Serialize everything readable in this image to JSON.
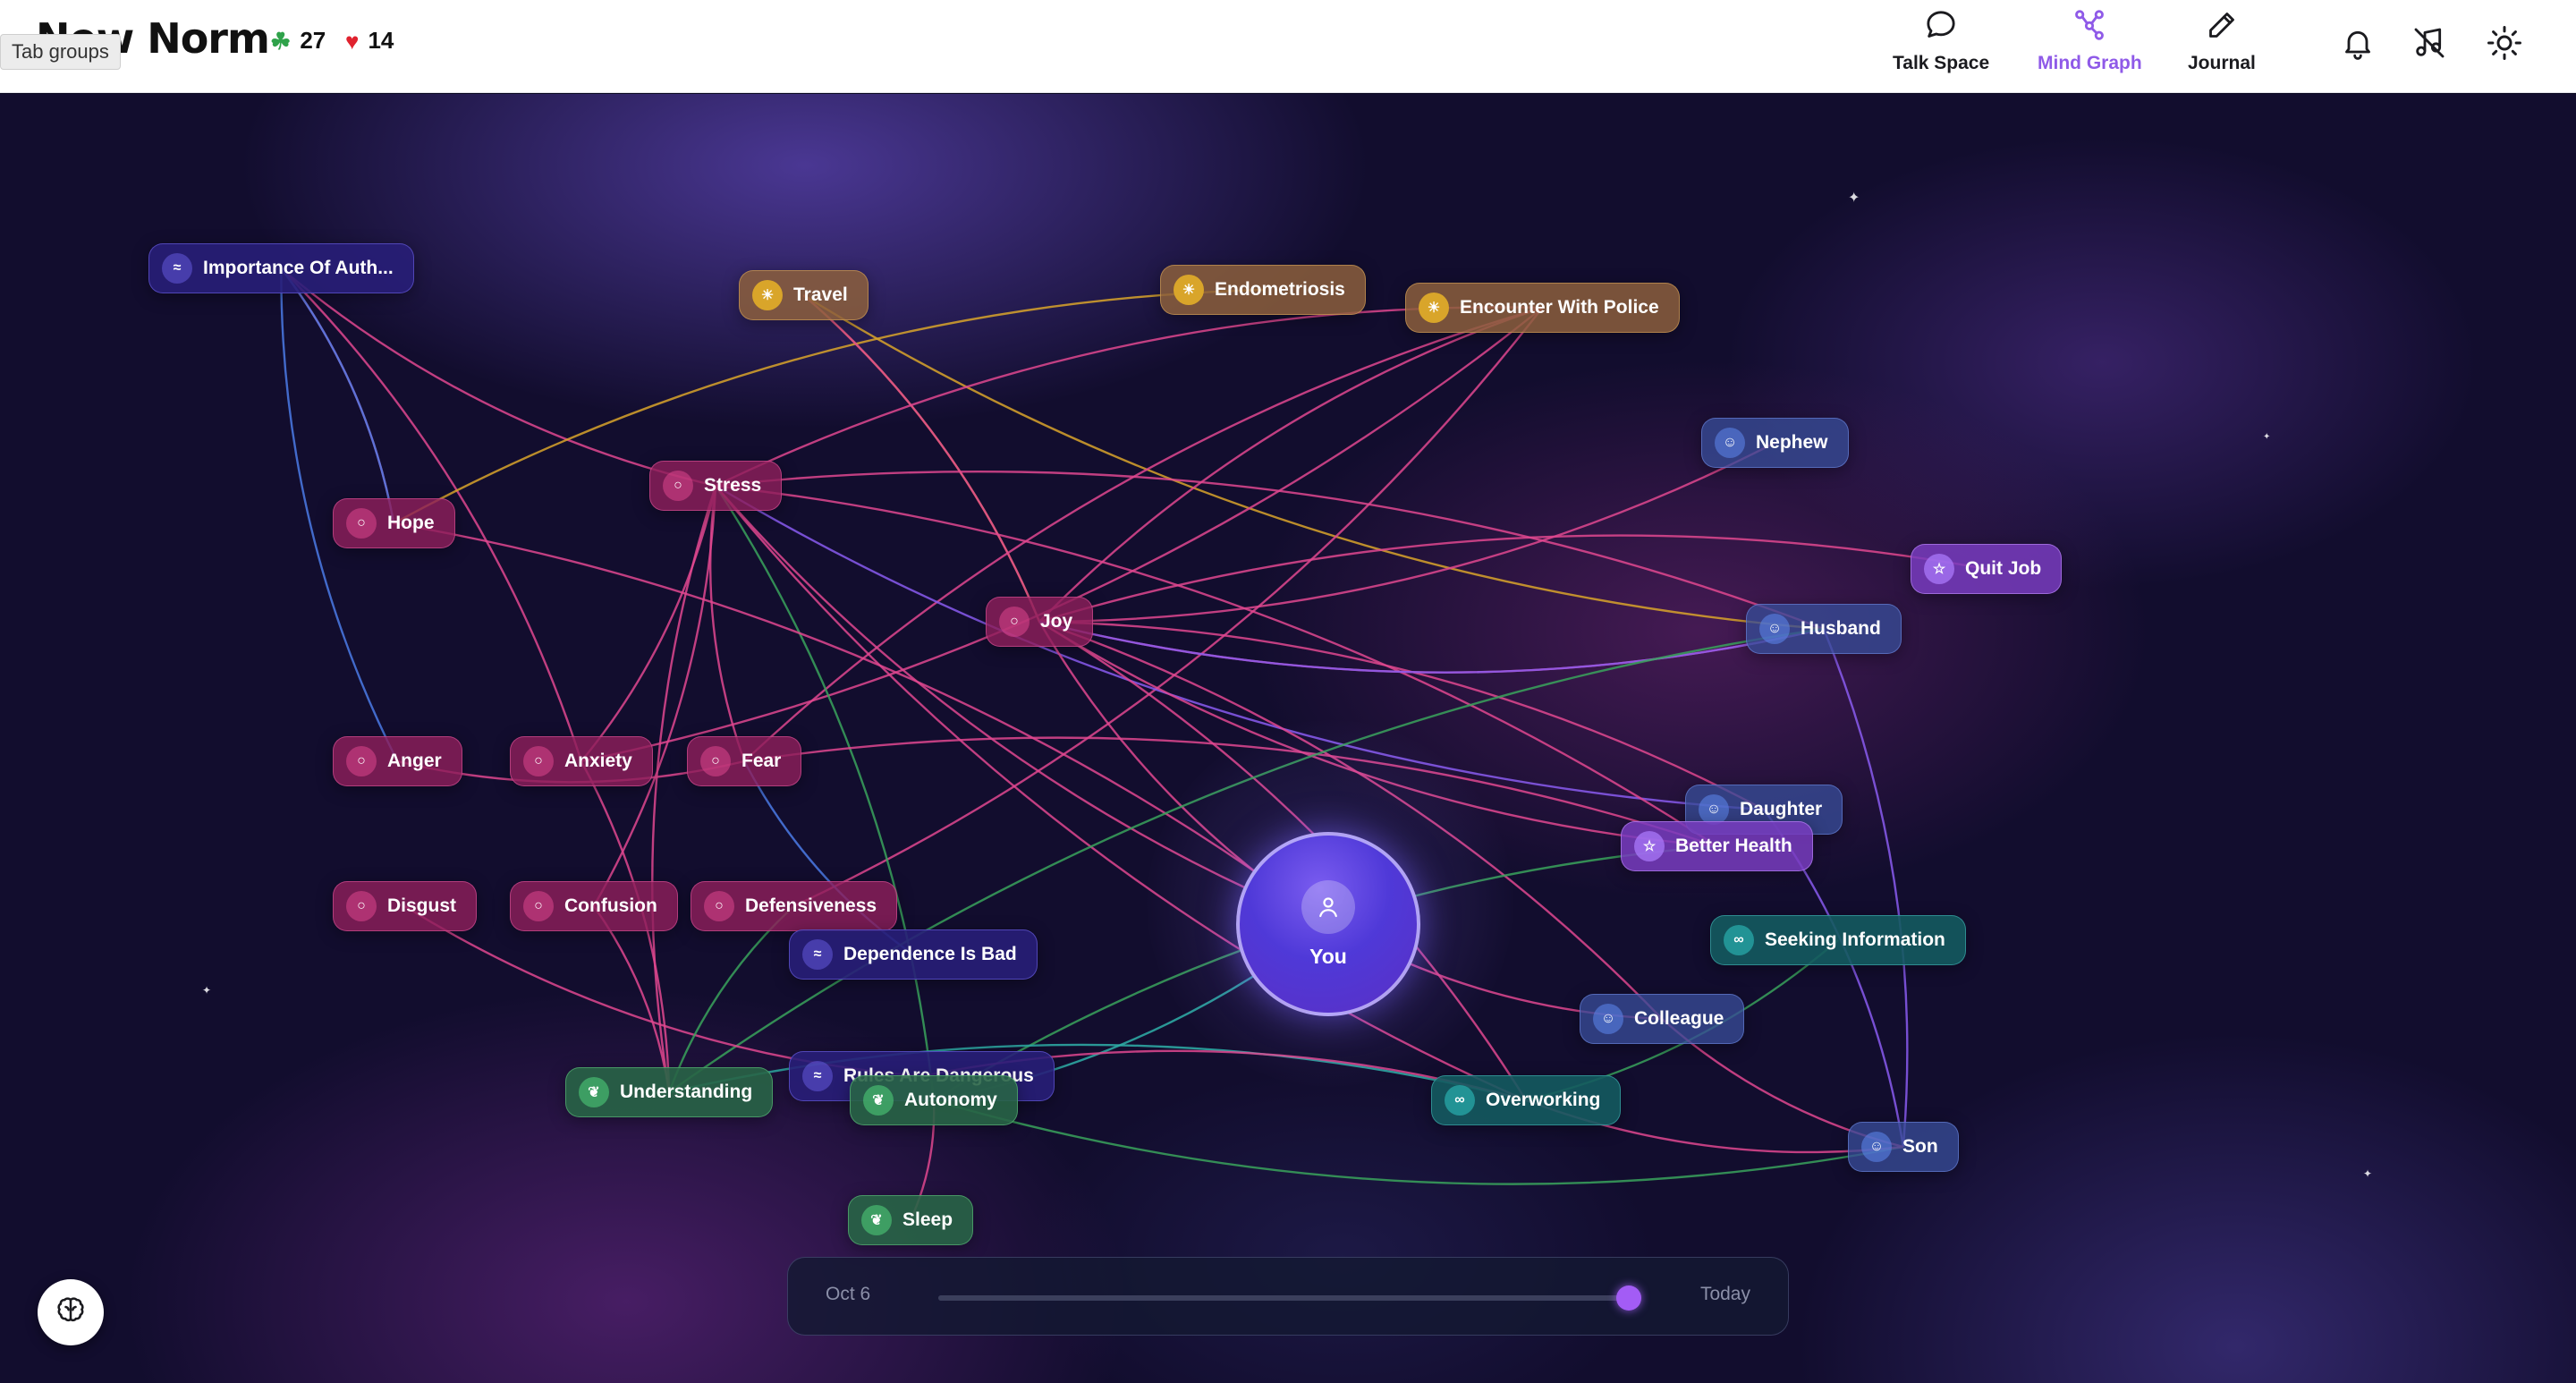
{
  "app": {
    "logo_text": "New Norm",
    "tooltip": "Tab groups",
    "streak_count": "27",
    "hearts_count": "14"
  },
  "nav": [
    {
      "label": "Talk Space",
      "icon": "chat-bubble-icon",
      "active": false
    },
    {
      "label": "Mind Graph",
      "icon": "graph-icon",
      "active": true
    },
    {
      "label": "Journal",
      "icon": "pencil-icon",
      "active": false
    }
  ],
  "header_icons": [
    "bell-icon",
    "music-off-icon",
    "sun-icon"
  ],
  "graph": {
    "center_label": "You",
    "nodes": [
      {
        "id": "importance",
        "label": "Importance Of Auth...",
        "type": "belief"
      },
      {
        "id": "travel",
        "label": "Travel",
        "type": "event"
      },
      {
        "id": "endometriosis",
        "label": "Endometriosis",
        "type": "event"
      },
      {
        "id": "police",
        "label": "Encounter With Police",
        "type": "event"
      },
      {
        "id": "nephew",
        "label": "Nephew",
        "type": "person"
      },
      {
        "id": "quitjob",
        "label": "Quit Job",
        "type": "goal"
      },
      {
        "id": "stress",
        "label": "Stress",
        "type": "emotion"
      },
      {
        "id": "hope",
        "label": "Hope",
        "type": "emotion"
      },
      {
        "id": "joy",
        "label": "Joy",
        "type": "emotion"
      },
      {
        "id": "husband",
        "label": "Husband",
        "type": "person"
      },
      {
        "id": "anger",
        "label": "Anger",
        "type": "emotion"
      },
      {
        "id": "anxiety",
        "label": "Anxiety",
        "type": "emotion"
      },
      {
        "id": "fear",
        "label": "Fear",
        "type": "emotion"
      },
      {
        "id": "daughter",
        "label": "Daughter",
        "type": "person"
      },
      {
        "id": "betterhealth",
        "label": "Better Health",
        "type": "goal"
      },
      {
        "id": "disgust",
        "label": "Disgust",
        "type": "emotion"
      },
      {
        "id": "confusion",
        "label": "Confusion",
        "type": "emotion"
      },
      {
        "id": "defensiveness",
        "label": "Defensiveness",
        "type": "emotion"
      },
      {
        "id": "dependence",
        "label": "Dependence Is Bad",
        "type": "belief"
      },
      {
        "id": "seeking",
        "label": "Seeking Information",
        "type": "behavior"
      },
      {
        "id": "colleague",
        "label": "Colleague",
        "type": "person"
      },
      {
        "id": "rulesdangerous",
        "label": "Rules Are Dangerous",
        "type": "belief"
      },
      {
        "id": "understanding",
        "label": "Understanding",
        "type": "need"
      },
      {
        "id": "autonomy",
        "label": "Autonomy",
        "type": "need"
      },
      {
        "id": "overworking",
        "label": "Overworking",
        "type": "behavior"
      },
      {
        "id": "son",
        "label": "Son",
        "type": "person"
      },
      {
        "id": "sleep",
        "label": "Sleep",
        "type": "need"
      }
    ]
  },
  "timeline": {
    "start_label": "Oct 6",
    "end_label": "Today",
    "position": 1.0
  },
  "colors": {
    "accent": "#8f5ae8",
    "edge_pink": "#e0488f",
    "edge_gold": "#d9a52a",
    "edge_blue": "#4b7be6",
    "edge_green": "#3aa35c",
    "edge_teal": "#2fb0a8",
    "edge_violet": "#8a5cf0"
  },
  "bottom_button_icon": "brain-icon"
}
